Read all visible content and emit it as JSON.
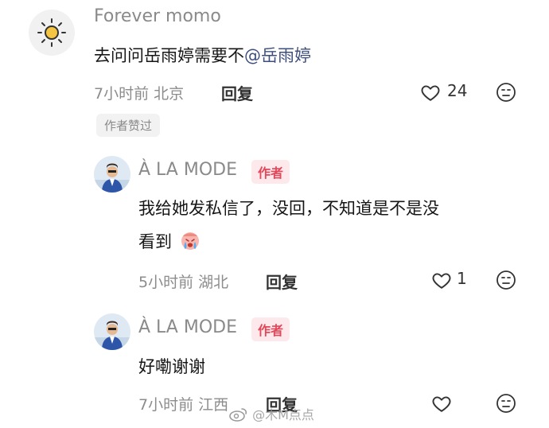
{
  "comment": {
    "username": "Forever momo",
    "text_prefix": "去问问岳雨婷需要不",
    "mention": "@岳雨婷",
    "meta_time_location": "7小时前 北京",
    "reply_label": "回复",
    "like_count": "24",
    "author_liked_badge": "作者赞过"
  },
  "replies": [
    {
      "username": "À LA MODE",
      "author_badge": "作者",
      "text_line1": "我给她发私信了，没回，不知道是不是没",
      "text_line2": "看到",
      "meta_time_location": "5小时前 湖北",
      "reply_label": "回复",
      "like_count": "1"
    },
    {
      "username": "À LA MODE",
      "author_badge": "作者",
      "text_line1": "好嘞谢谢",
      "meta_time_location": "7小时前 江西",
      "reply_label": "回复",
      "like_count": ""
    }
  ],
  "watermark": "@木M点点",
  "icons": {
    "avatar1": "sun-avatar-icon",
    "like": "heart-icon",
    "dislike": "frown-face-icon",
    "emoji": "crying-emoji-icon",
    "watermark_logo": "weibo-logo-icon"
  },
  "colors": {
    "mention": "#3e4f7e",
    "author_badge_bg": "#fde9ec",
    "author_badge_text": "#e2485a",
    "meta_text": "#8c8c8c"
  }
}
